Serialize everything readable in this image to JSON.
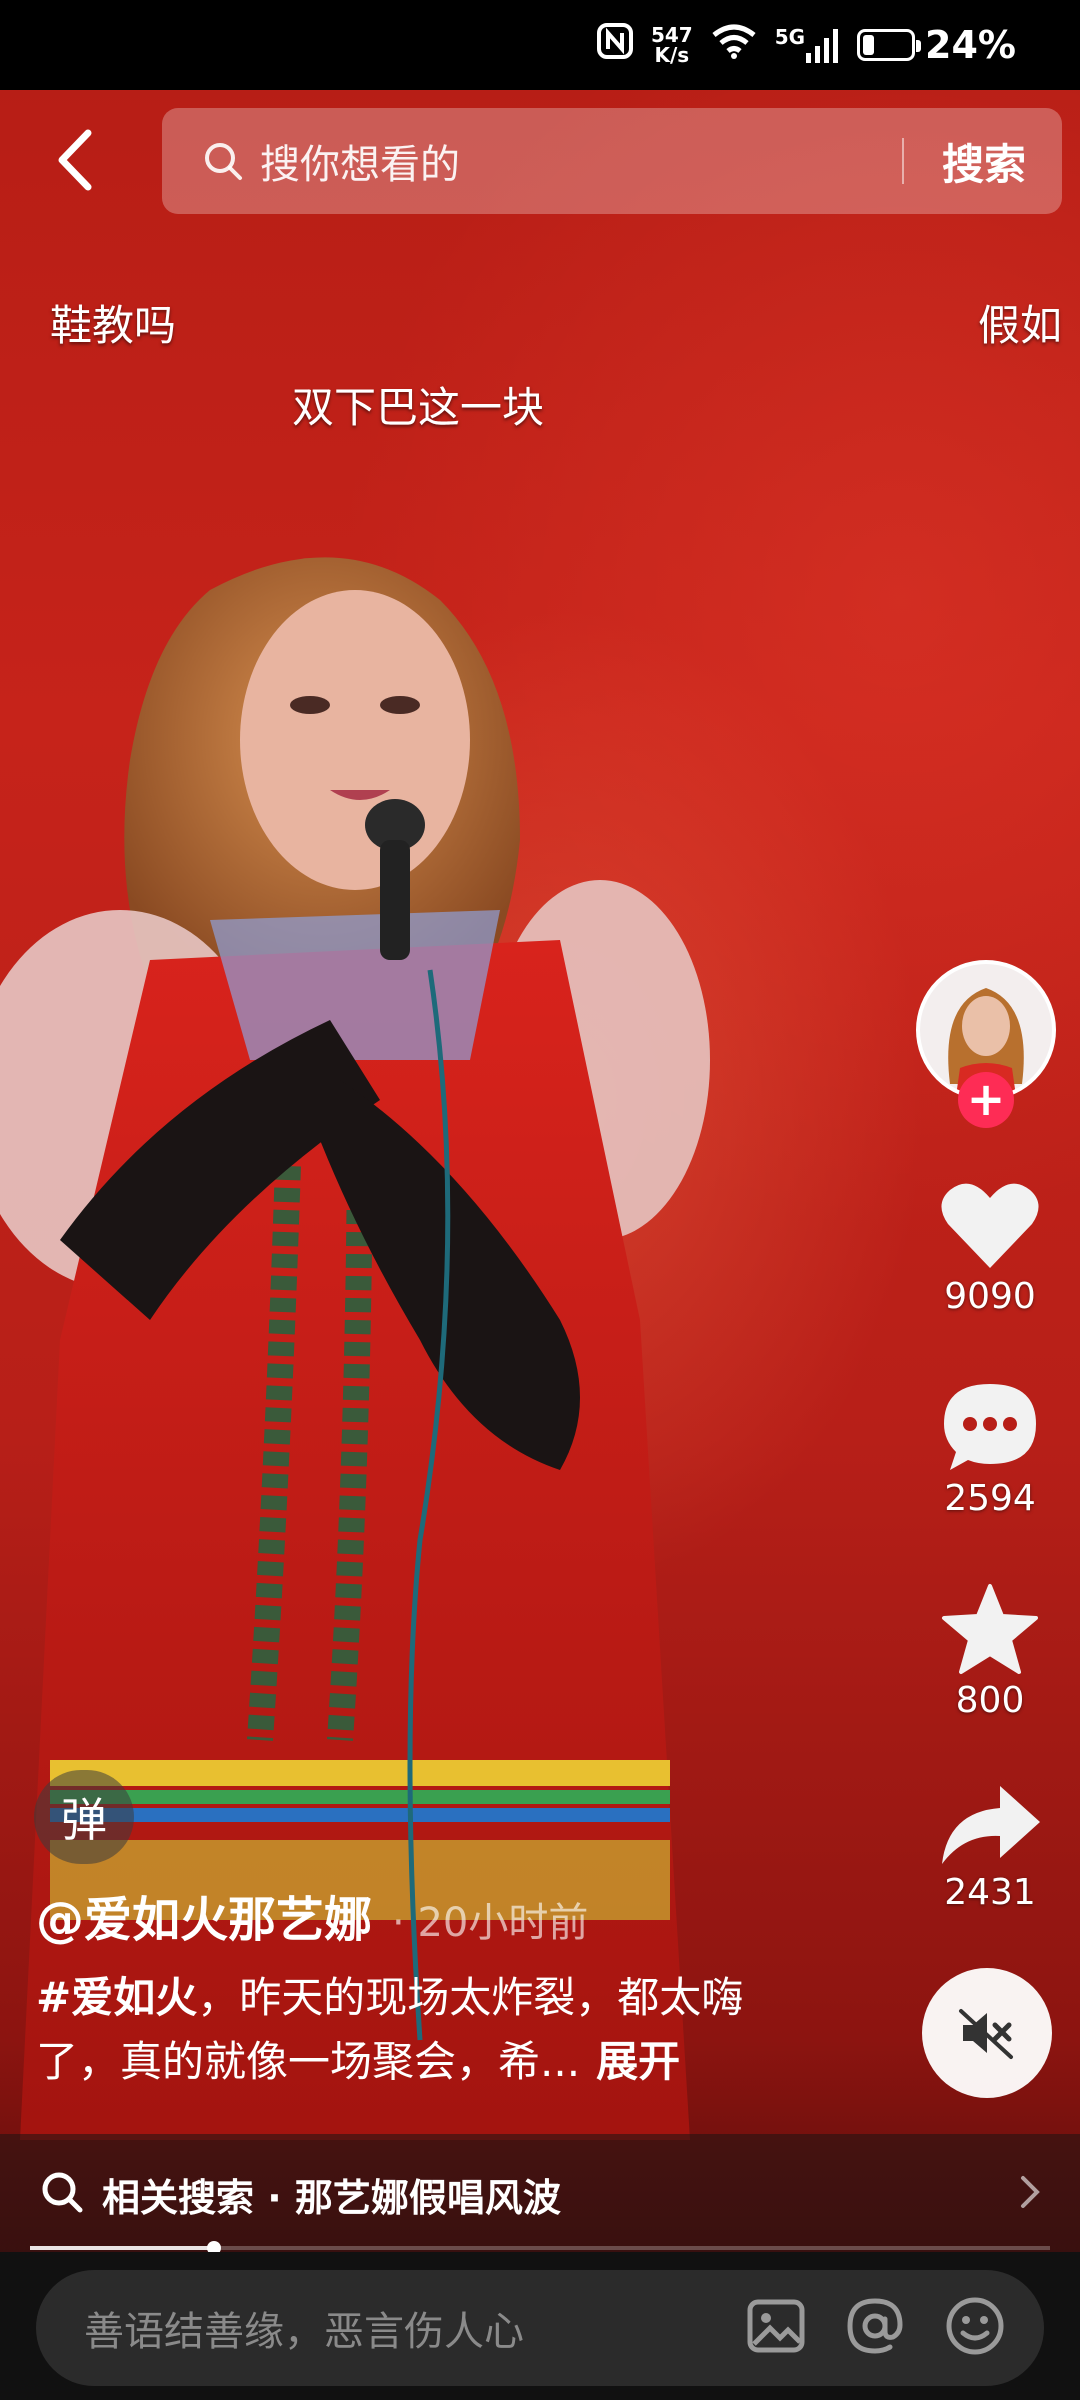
{
  "status_bar": {
    "speed_value": "547",
    "speed_unit": "K/s",
    "network": "5G",
    "battery_percent": "24%",
    "battery_level": 0.24
  },
  "search": {
    "placeholder": "搜你想看的",
    "submit_label": "搜索"
  },
  "danmaku": [
    {
      "text": "鞋教吗"
    },
    {
      "text": "双下巴这一块"
    },
    {
      "text": "假如"
    }
  ],
  "actions": {
    "likes": "9090",
    "comments": "2594",
    "favorites": "800",
    "shares": "2431",
    "follow_symbol": "+"
  },
  "video": {
    "danmu_toggle": "弹",
    "author": "@爱如火那艺娜",
    "time": "· 20小时前",
    "hashtag": "#爱如火",
    "description": "，昨天的现场太炸裂，都太嗨了，真的就像一场聚会，希...",
    "expand_label": "展开",
    "progress": 0.18
  },
  "related_search": {
    "label": "相关搜索 · 那艺娜假唱风波"
  },
  "comment": {
    "placeholder": "善语结善缘，恶言伤人心"
  },
  "colors": {
    "accent": "#fe2c55",
    "background": "#c6231a"
  },
  "icons": [
    "back-icon",
    "search-icon",
    "heart-icon",
    "comment-icon",
    "star-icon",
    "share-icon",
    "mute-icon",
    "chevron-right-icon",
    "image-icon",
    "at-icon",
    "emoji-icon",
    "nfc-icon",
    "wifi-icon",
    "signal-icon"
  ]
}
